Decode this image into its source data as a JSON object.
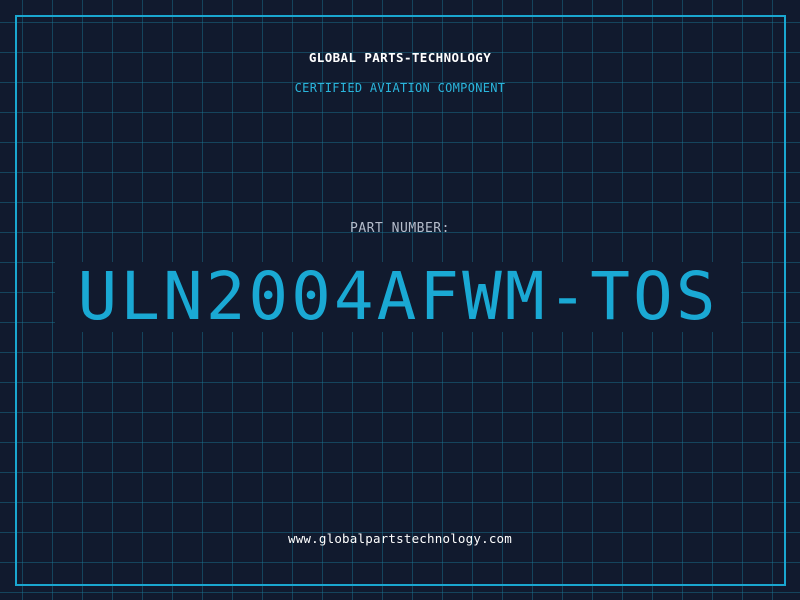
{
  "header": {
    "brand": "GLOBAL PARTS-TECHNOLOGY",
    "subtitle": "CERTIFIED AVIATION COMPONENT"
  },
  "part": {
    "label": "PART NUMBER:",
    "number": "ULN2004AFWM-TOS"
  },
  "footer": {
    "url": "www.globalpartstechnology.com"
  },
  "colors": {
    "background": "#111a2e",
    "grid": "#1b7896",
    "accent": "#1aa9d4",
    "text": "#ffffff",
    "label": "#b5bccb"
  }
}
